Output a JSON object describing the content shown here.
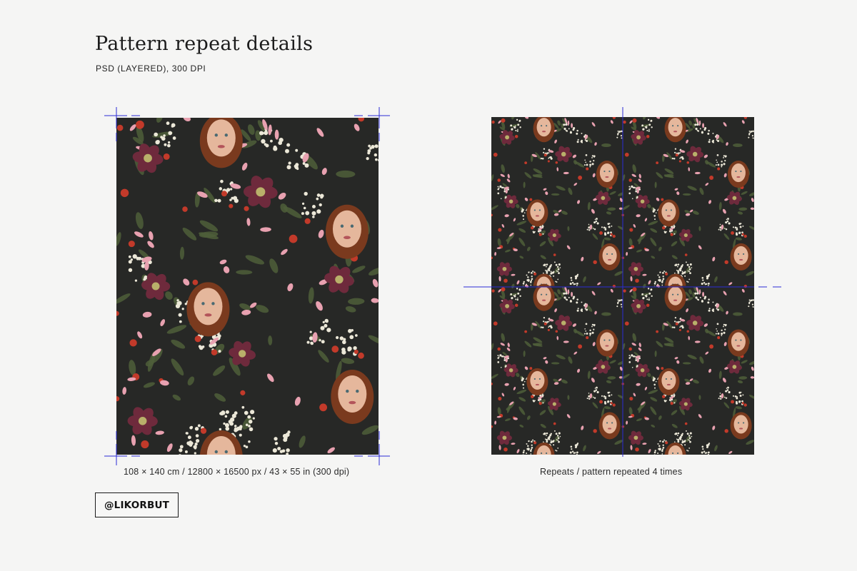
{
  "header": {
    "title": "Pattern repeat details",
    "subtitle": "PSD (LAYERED), 300 DPI"
  },
  "single_tile": {
    "caption": "108 × 140 cm / 12800 × 16500 px / 43 × 55 in (300 dpi)"
  },
  "repeat_preview": {
    "caption": "Repeats / pattern repeated 4 times",
    "repeat_count": 4
  },
  "logo": {
    "text": "@LIKORBUT"
  },
  "colors": {
    "background": "#f5f5f4",
    "pattern_ground": "#272826",
    "guide_line": "#2b2bd6",
    "plum_flower": "#6e2a3c",
    "pink_flower": "#e8a1b0",
    "red_berry": "#c23a2a",
    "white_blossom": "#ece8d8",
    "leaf": "#4f5e3a",
    "hair": "#7a3a1e",
    "skin": "#e5b79c"
  }
}
